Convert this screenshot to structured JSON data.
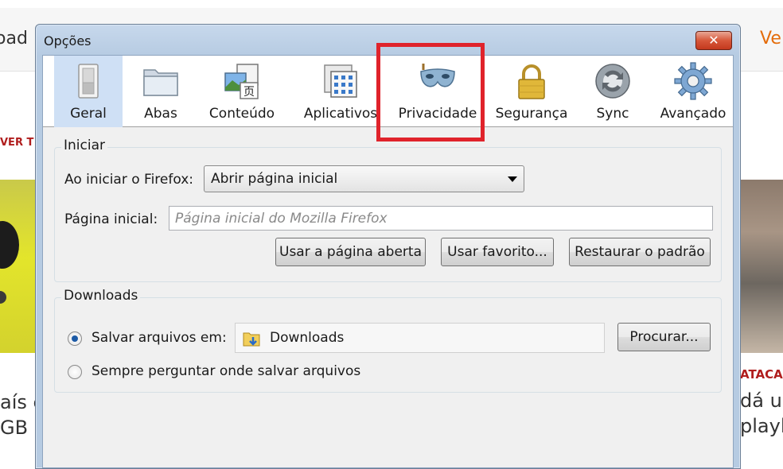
{
  "background": {
    "left_top_text": "oad",
    "right_top_text": "Ve",
    "left_small_text": "VER T",
    "left_bottom_text": [
      "aís e",
      "GB"
    ],
    "right_small_text": "ATACA",
    "right_bottom_text": [
      "dá um",
      "playlis"
    ]
  },
  "dialog": {
    "title": "Opções",
    "close_glyph": "✕"
  },
  "tabs": [
    {
      "label": "Geral",
      "icon": "switch-icon"
    },
    {
      "label": "Abas",
      "icon": "folder-icon"
    },
    {
      "label": "Conteúdo",
      "icon": "content-icon"
    },
    {
      "label": "Aplicativos",
      "icon": "applications-icon"
    },
    {
      "label": "Privacidade",
      "icon": "mask-icon"
    },
    {
      "label": "Segurança",
      "icon": "lock-icon"
    },
    {
      "label": "Sync",
      "icon": "sync-icon"
    },
    {
      "label": "Avançado",
      "icon": "gear-icon"
    }
  ],
  "highlight_color": "#e0232b",
  "startup": {
    "title": "Iniciar",
    "on_start_label": "Ao iniciar o Firefox:",
    "on_start_value": "Abrir página inicial",
    "homepage_label": "Página inicial:",
    "homepage_placeholder": "Página inicial do Mozilla Firefox",
    "btn_use_current": "Usar a página aberta",
    "btn_use_bookmark": "Usar favorito...",
    "btn_restore": "Restaurar o padrão"
  },
  "downloads": {
    "title": "Downloads",
    "save_label": "Salvar arquivos em:",
    "folder": "Downloads",
    "browse": "Procurar...",
    "ask_label": "Sempre perguntar onde salvar arquivos"
  }
}
